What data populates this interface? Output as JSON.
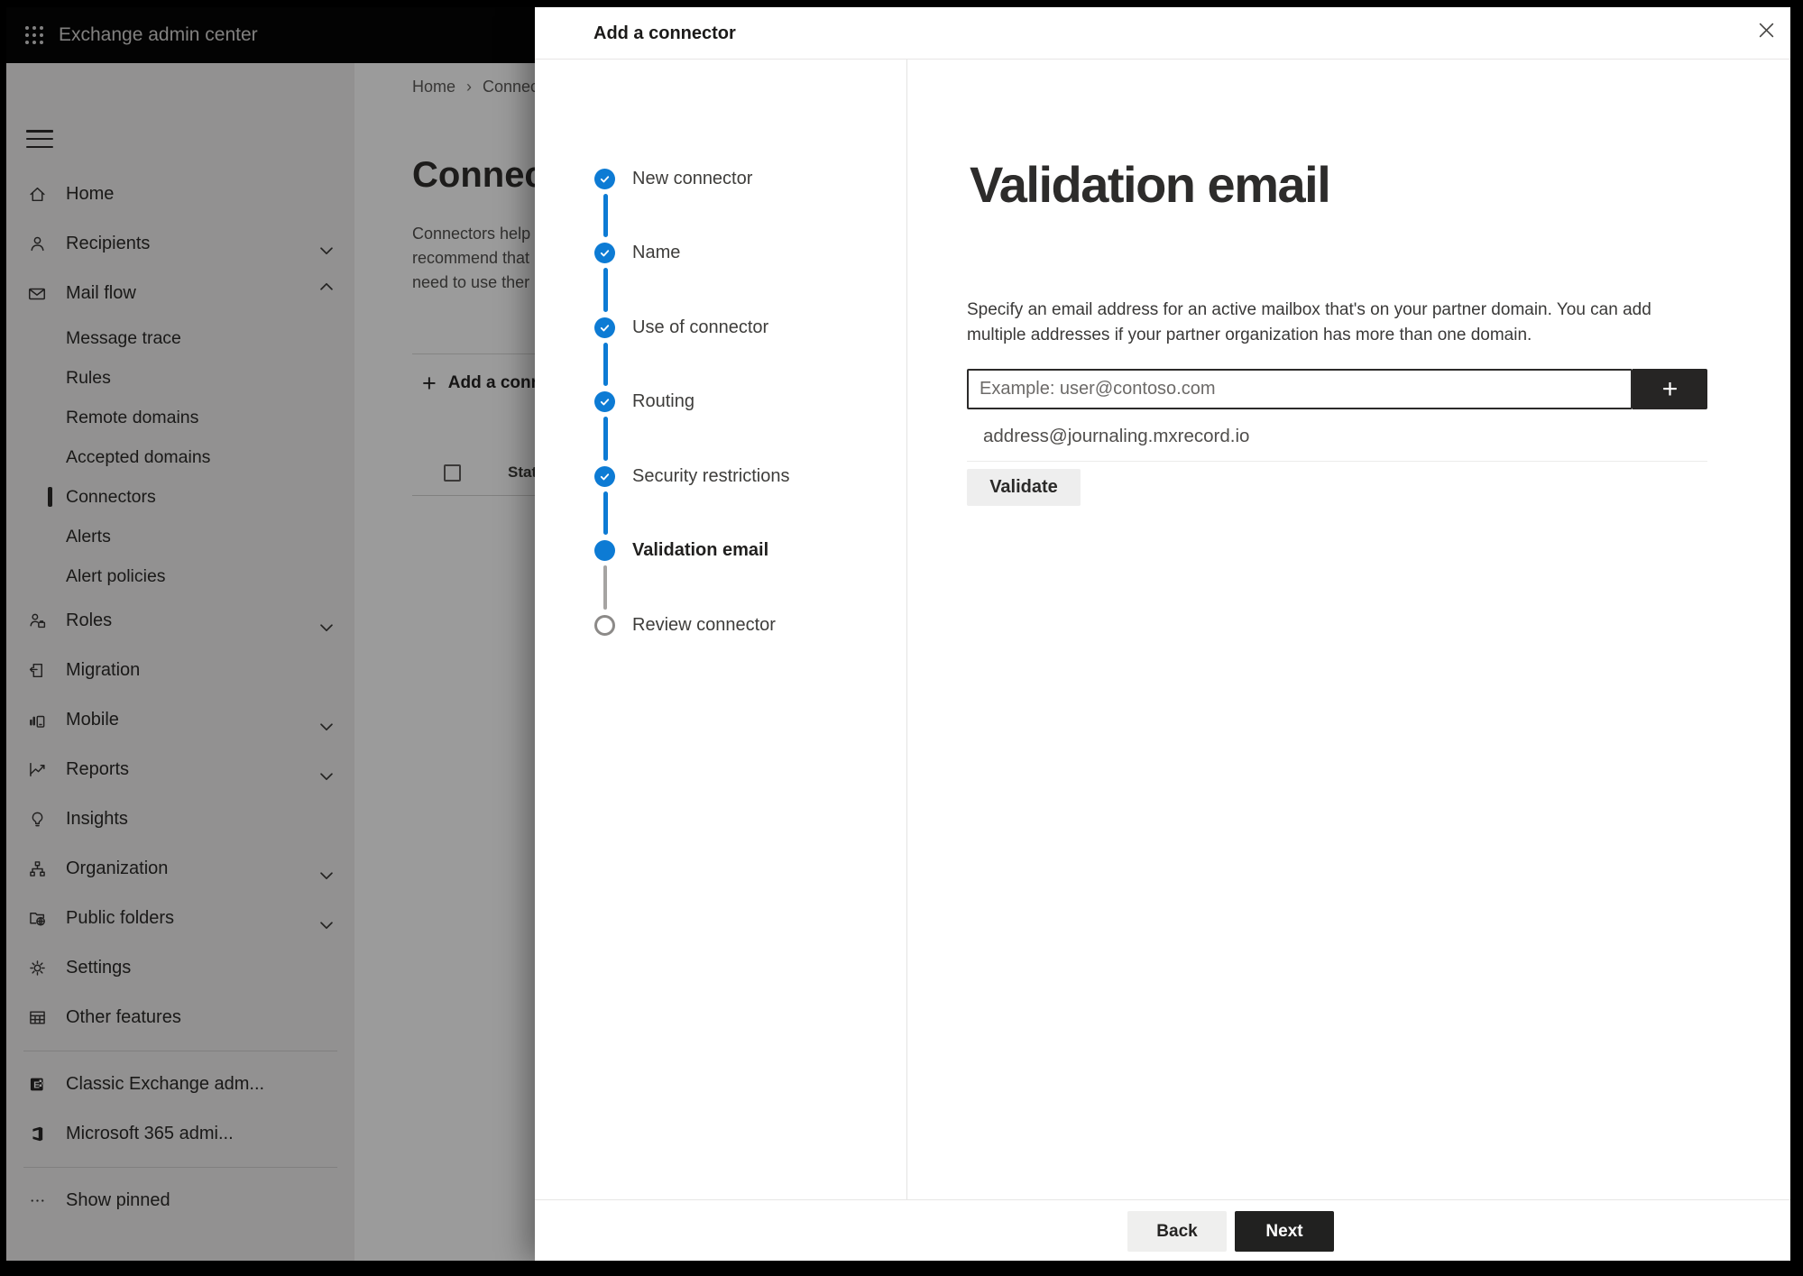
{
  "topbar": {
    "title": "Exchange admin center",
    "app_launcher_icon": "app-launcher"
  },
  "sidebar": {
    "hamburger_icon": "hamburger",
    "items": [
      {
        "label": "Home",
        "icon": "home-icon"
      },
      {
        "label": "Recipients",
        "icon": "person-icon",
        "chevron": "down"
      },
      {
        "label": "Mail flow",
        "icon": "mail-icon",
        "chevron": "up",
        "expanded": true
      },
      {
        "label": "Message trace",
        "type": "sub"
      },
      {
        "label": "Rules",
        "type": "sub"
      },
      {
        "label": "Remote domains",
        "type": "sub"
      },
      {
        "label": "Accepted domains",
        "type": "sub"
      },
      {
        "label": "Connectors",
        "type": "sub",
        "selected": true
      },
      {
        "label": "Alerts",
        "type": "sub"
      },
      {
        "label": "Alert policies",
        "type": "sub"
      },
      {
        "label": "Roles",
        "icon": "roles-icon",
        "chevron": "down"
      },
      {
        "label": "Migration",
        "icon": "migration-icon"
      },
      {
        "label": "Mobile",
        "icon": "mobile-icon",
        "chevron": "down"
      },
      {
        "label": "Reports",
        "icon": "reports-icon",
        "chevron": "down"
      },
      {
        "label": "Insights",
        "icon": "lightbulb-icon"
      },
      {
        "label": "Organization",
        "icon": "org-tree-icon",
        "chevron": "down"
      },
      {
        "label": "Public folders",
        "icon": "folder-globe-icon",
        "chevron": "down"
      },
      {
        "label": "Settings",
        "icon": "gear-icon"
      },
      {
        "label": "Other features",
        "icon": "grid-table-icon"
      },
      {
        "label": "Classic Exchange adm...",
        "icon": "classic-exchange-icon"
      },
      {
        "label": "Microsoft 365 admi...",
        "icon": "microsoft-365-icon"
      },
      {
        "label": "Show pinned",
        "icon": "ellipsis-icon"
      }
    ]
  },
  "page": {
    "breadcrumb": {
      "home": "Home",
      "separator": "›",
      "current": "Connectors"
    },
    "title": "Connectors",
    "description_lines": [
      "Connectors help",
      "recommend that",
      "need to use ther"
    ],
    "add_button_label": "Add a connector",
    "add_icon": "+",
    "table": {
      "status_header": "Status"
    }
  },
  "modal": {
    "title": "Add a connector",
    "close_icon": "close",
    "steps": [
      {
        "label": "New connector",
        "state": "done"
      },
      {
        "label": "Name",
        "state": "done"
      },
      {
        "label": "Use of connector",
        "state": "done"
      },
      {
        "label": "Routing",
        "state": "done"
      },
      {
        "label": "Security restrictions",
        "state": "done"
      },
      {
        "label": "Validation email",
        "state": "current"
      },
      {
        "label": "Review connector",
        "state": "upcoming"
      }
    ],
    "content": {
      "heading": "Validation email",
      "description": "Specify an email address for an active mailbox that's on your partner domain. You can add multiple addresses if your partner organization has more than one domain.",
      "email_input": {
        "value": "",
        "placeholder": "Example: user@contoso.com"
      },
      "add_address_button": "+",
      "addresses": [
        {
          "email": "address@journaling.mxrecord.io",
          "delete_icon": "trash-icon"
        }
      ],
      "validate_button": "Validate"
    },
    "footer": {
      "back_button": "Back",
      "next_button": "Next"
    }
  },
  "colors": {
    "accent_blue": "#0078d4",
    "dark_button": "#212120",
    "topbar_background": "#060606",
    "upcoming_step_gray": "#8c8a88"
  }
}
